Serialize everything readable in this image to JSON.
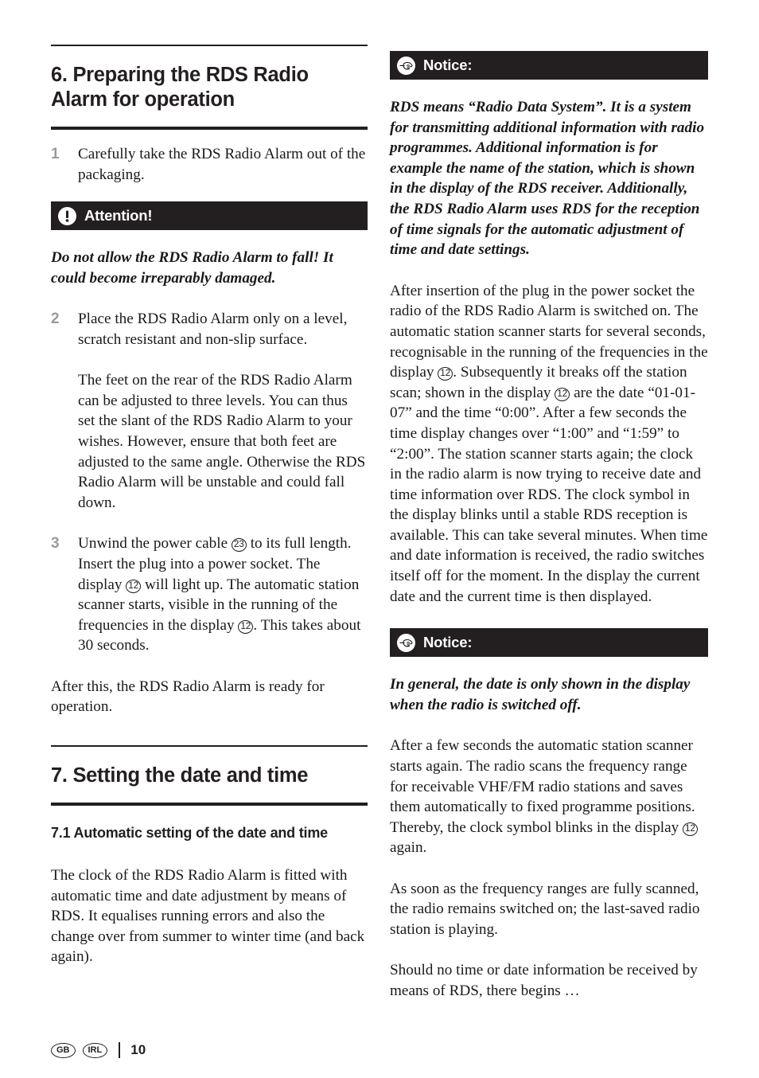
{
  "page": {
    "number": "10",
    "locales": [
      "GB",
      "IRL"
    ],
    "accent_color": "#231f20",
    "number_marker_color": "#9b9b9b"
  },
  "left_column": {
    "section_heading": "6. Preparing the RDS Radio Alarm for operation",
    "items": [
      {
        "number": "1",
        "text": "Carefully take the RDS Radio Alarm out of the packaging."
      },
      {
        "number": "2",
        "text": "Place the RDS Radio Alarm only on a level, scratch resistant and non-slip surface.",
        "continuation": "The feet on the rear of the RDS Radio Alarm can be adjusted to three levels. You can thus set the slant of the RDS Radio Alarm to your wishes. However, ensure that both feet are adjusted to the same angle. Otherwise the RDS Radio Alarm will be unstable and could fall down."
      },
      {
        "number": "3",
        "text_part1": "Unwind the power cable ",
        "ref1": "23",
        "text_part2": " to its full length. Insert the plug into a power socket. The display ",
        "ref2": "12",
        "text_part3": " will light up. The automatic station scanner starts, visible in the running of the frequencies in the display ",
        "ref3": "12",
        "text_part4": ". This takes about 30 seconds."
      }
    ],
    "attention_callout": {
      "icon": "exclamation-circle-icon",
      "label": "Attention!",
      "text": "Do not allow the RDS Radio Alarm to fall! It could become irreparably damaged."
    },
    "closing_paragraph": "After this, the RDS Radio Alarm is ready for operation.",
    "section7_heading": "7. Setting the date and time",
    "section71_heading": "7.1 Automatic setting of the date and time",
    "section71_paragraph": "The clock of the RDS Radio Alarm is fitted with automatic time and date adjustment by means of RDS. It equalises running errors and also the change over from summer to winter time (and back again)."
  },
  "right_column": {
    "notice1": {
      "icon": "pointing-hand-icon",
      "label": "Notice:",
      "text": "RDS means “Radio Data System”. It is a system for transmitting additional information with radio programmes. Additional information is for example the name of the station, which is shown in the display of the RDS receiver. Additionally, the RDS Radio Alarm uses RDS for the reception of time signals for the automatic adjustment of time and date settings."
    },
    "paragraph1": {
      "part1": "After insertion of the plug in the power socket the radio of the RDS Radio Alarm is switched on. The automatic station scanner starts for several seconds, recognisable in the running of the frequencies in the display ",
      "ref1": "12",
      "part2": ". Subsequently it breaks off the station scan; shown in the display ",
      "ref2": "12",
      "part3": " are the date “01-01-07” and the time “0:00”. After a few seconds the time display changes over “1:00” and “1:59” to “2:00”. The station scanner starts again; the clock in the radio alarm is now trying to receive date and time information over RDS. The clock symbol in the display blinks until a stable RDS reception is available. This can take several minutes. When time and date information is received, the radio switches itself off for the moment. In the display the current date and the current time is then displayed."
    },
    "notice2": {
      "icon": "pointing-hand-icon",
      "label": "Notice:",
      "text": "In general, the date is only shown in the display when the radio is switched off."
    },
    "paragraph2": {
      "part1": "After a few seconds the automatic station scanner starts again. The radio scans the frequency range for receivable VHF/FM radio stations and saves them automatically to fixed programme positions. Thereby, the clock symbol blinks in the display ",
      "ref1": "12",
      "part2": " again."
    },
    "paragraph3": "As soon as the frequency ranges are fully scanned, the radio remains switched on; the last-saved radio station is playing.",
    "paragraph4": "Should no time or date information be received by means of RDS, there begins …"
  }
}
